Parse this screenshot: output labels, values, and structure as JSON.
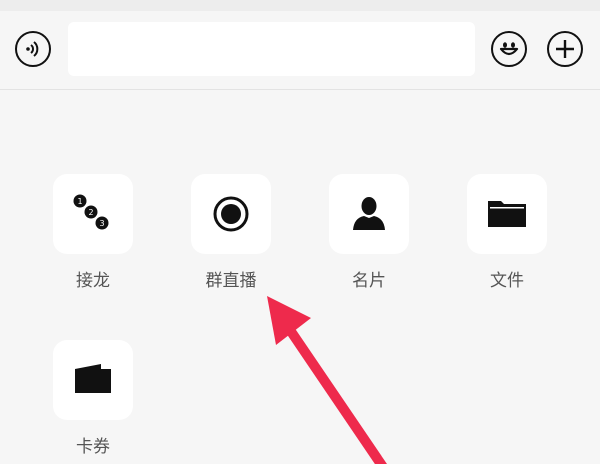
{
  "input_bar": {
    "voice_icon": "voice-input-icon",
    "text_value": "",
    "emoji_icon": "emoji-icon",
    "plus_icon": "plus-icon"
  },
  "panel": {
    "items": [
      {
        "label": "接龙",
        "icon": "chain-relay-icon"
      },
      {
        "label": "群直播",
        "icon": "live-record-icon"
      },
      {
        "label": "名片",
        "icon": "contact-card-icon"
      },
      {
        "label": "文件",
        "icon": "folder-icon"
      },
      {
        "label": "卡券",
        "icon": "coupon-wallet-icon"
      }
    ]
  },
  "colors": {
    "background": "#f6f6f6",
    "tile": "#ffffff",
    "label": "#555555",
    "annotation_arrow": "#ee2a4c"
  }
}
